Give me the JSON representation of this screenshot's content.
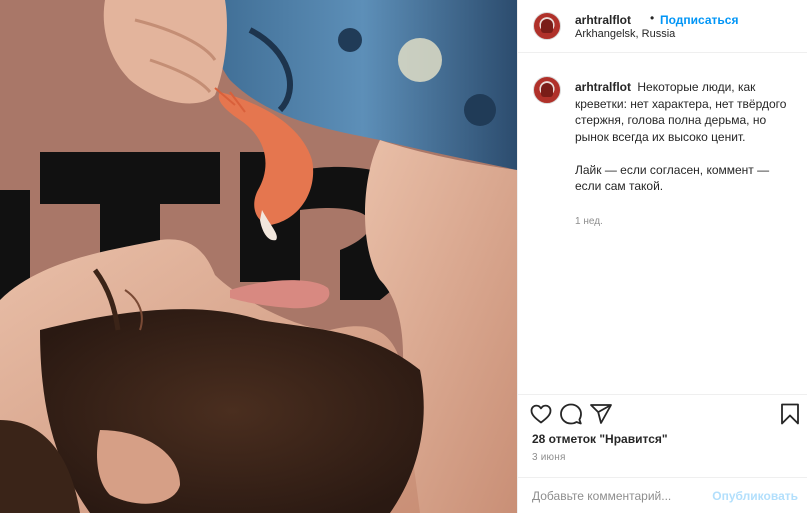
{
  "post": {
    "username": "arhtralflot",
    "separator": "•",
    "follow_label": "Подписаться",
    "location": "Arkhangelsk, Russia",
    "caption": {
      "paragraph1": "Некоторые люди, как креветки: нет характера, нет твёрдого стержня, голова полна дерьма, но рынок всегда их высоко ценит.",
      "paragraph2": "Лайк — если согласен, коммент — если сам такой.",
      "time": "1 нед."
    },
    "likes_text": "28 отметок \"Нравится\"",
    "date": "3 июня",
    "comment_placeholder": "Добавьте комментарий...",
    "publish_label": "Опубликовать"
  },
  "icons": {
    "like": "heart-icon",
    "comment": "comment-icon",
    "share": "share-icon",
    "save": "bookmark-icon"
  },
  "colors": {
    "link": "#0095f6",
    "publish_disabled": "#b2dffc",
    "muted": "#8e8e8e",
    "photo_background": "#a7776a"
  }
}
